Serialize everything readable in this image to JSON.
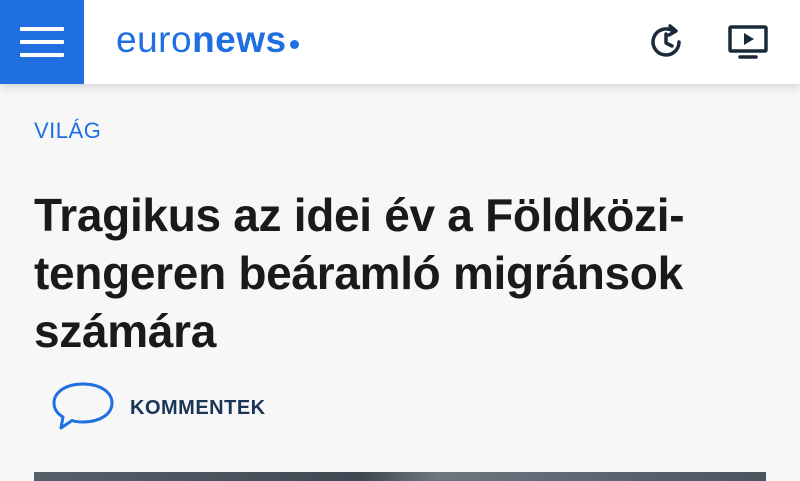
{
  "header": {
    "logo_part1": "euro",
    "logo_part2": "news",
    "brand_color": "#1f6fe0",
    "menu_icon": "hamburger-menu-icon",
    "history_icon": "history-clock-icon",
    "live_icon": "live-tv-icon"
  },
  "article": {
    "category": "VILÁG",
    "title": "Tragikus az idei év a Földközi-tengeren beáramló migránsok számára",
    "comments_label": "KOMMENTEK",
    "comments_icon": "speech-bubble-icon",
    "title_color": "#1a1a1a",
    "comments_color": "#1a3556"
  }
}
